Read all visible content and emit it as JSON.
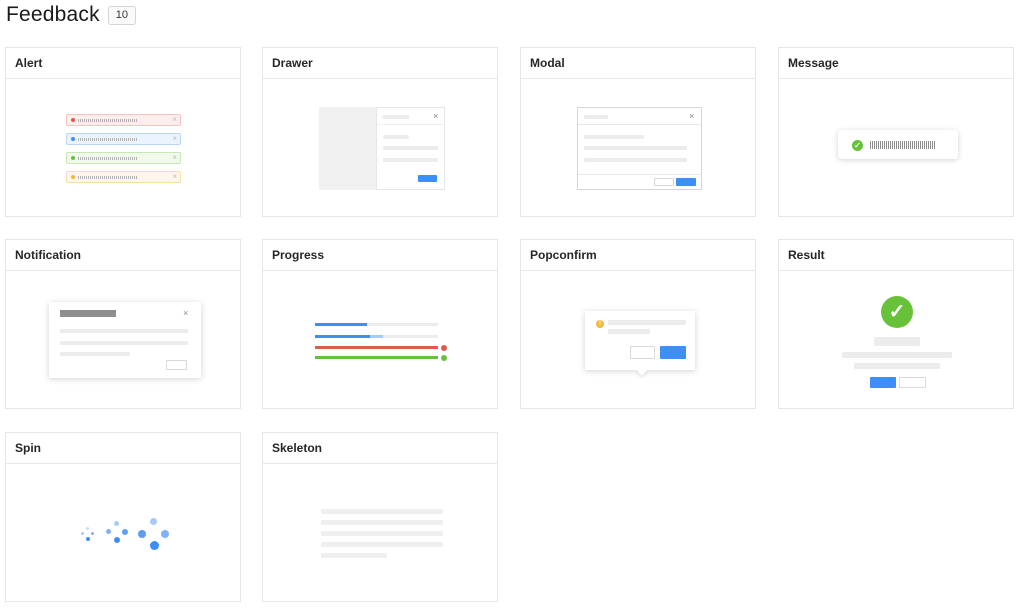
{
  "header": {
    "title": "Feedback",
    "count": "10"
  },
  "cards": [
    {
      "title": "Alert"
    },
    {
      "title": "Drawer"
    },
    {
      "title": "Modal"
    },
    {
      "title": "Message"
    },
    {
      "title": "Notification"
    },
    {
      "title": "Progress"
    },
    {
      "title": "Popconfirm"
    },
    {
      "title": "Result"
    },
    {
      "title": "Spin"
    },
    {
      "title": "Skeleton"
    }
  ],
  "icons": {
    "close": "close-icon",
    "success": "check-circle-icon",
    "warning": "exclamation-circle-icon",
    "error": "close-circle-icon",
    "loading": "spinner-icon"
  },
  "colors": {
    "primary": "#3e8ef7",
    "success": "#67c23a",
    "error": "#e05a4f",
    "warning": "#f0b93a"
  },
  "progress": {
    "bars": [
      0.42,
      0.55,
      0.99,
      1.0
    ]
  }
}
